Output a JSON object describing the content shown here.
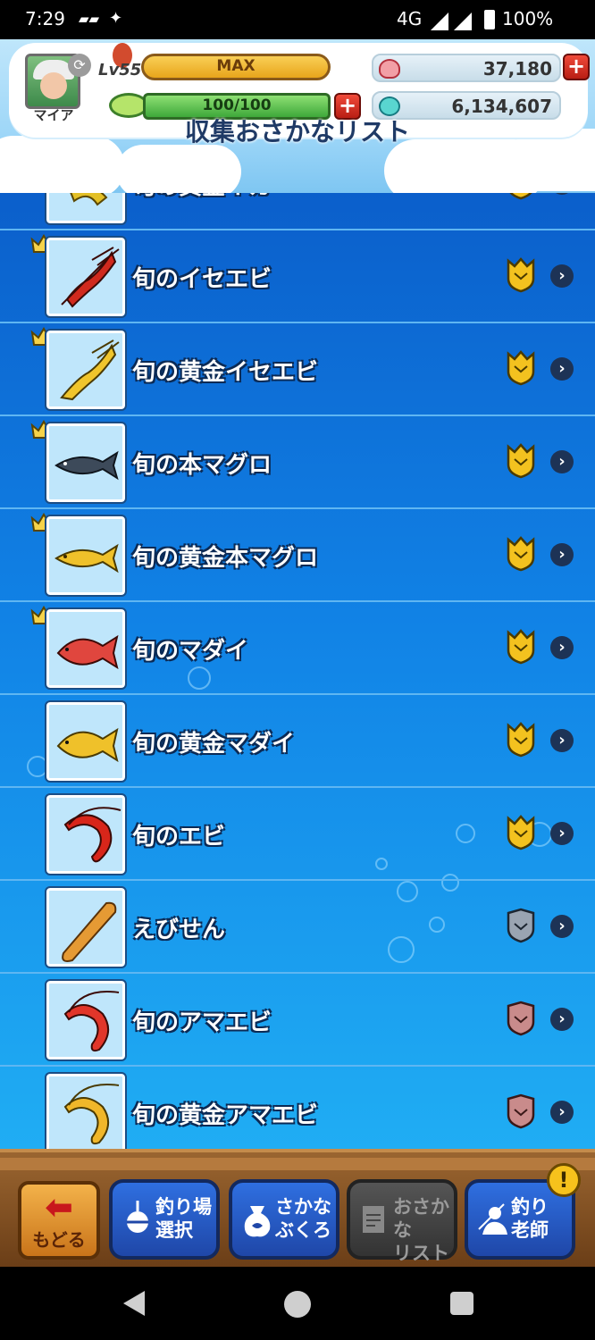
{
  "status_bar": {
    "time": "7:29",
    "network": "4G",
    "battery": "100%"
  },
  "header": {
    "player_name": "マイア",
    "level": "Lv55",
    "exp_label": "MAX",
    "stamina": "100/100",
    "red_currency": "37,180",
    "blue_currency": "6,134,607",
    "title": "収集おさかなリスト"
  },
  "list": {
    "partial_top_name": "旬の黄金イカ",
    "items": [
      {
        "name": "旬のイセエビ",
        "crown": true,
        "badge": "gold"
      },
      {
        "name": "旬の黄金イセエビ",
        "crown": true,
        "badge": "gold"
      },
      {
        "name": "旬の本マグロ",
        "crown": true,
        "badge": "gold"
      },
      {
        "name": "旬の黄金本マグロ",
        "crown": true,
        "badge": "gold"
      },
      {
        "name": "旬のマダイ",
        "crown": true,
        "badge": "gold"
      },
      {
        "name": "旬の黄金マダイ",
        "crown": false,
        "badge": "gold"
      },
      {
        "name": "旬のエビ",
        "crown": false,
        "badge": "gold"
      },
      {
        "name": "えびせん",
        "crown": false,
        "badge": "silver"
      },
      {
        "name": "旬のアマエビ",
        "crown": false,
        "badge": "bronze"
      },
      {
        "name": "旬の黄金アマエビ",
        "crown": false,
        "badge": "bronze"
      }
    ]
  },
  "bottom_nav": {
    "back": "もどる",
    "spot_line1": "釣り場",
    "spot_line2": "選択",
    "bag_line1": "さかな",
    "bag_line2": "ぶくろ",
    "list_line1": "おさかな",
    "list_line2": "リスト",
    "teacher_line1": "釣り",
    "teacher_line2": "老師",
    "alert": "!"
  },
  "colors": {
    "gold_badge": "#f3c21f",
    "silver_badge": "#9aa4b2",
    "bronze_badge": "#c98b8b",
    "crown": "#f6d34a"
  }
}
